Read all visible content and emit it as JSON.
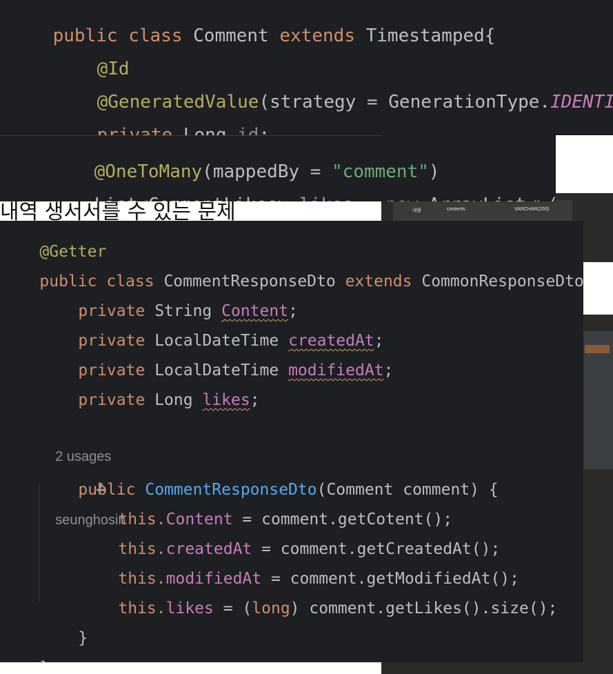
{
  "top_snippet": {
    "line1": {
      "kw1": "public",
      "kw2": "class",
      "name": "Comment",
      "kw3": "extends",
      "parent": "Timestamped{"
    },
    "line2": {
      "ann": "@Id"
    },
    "line3": {
      "ann": "@GeneratedValue",
      "open": "(strategy = GenerationType.",
      "value": "IDENTITY",
      "close": ")"
    },
    "line4": {
      "kw": "private",
      "type": "Long",
      "field": "id",
      "semi": ";"
    }
  },
  "mid_snippet": {
    "line1": {
      "ann": "@OneToMany",
      "open": "(mappedBy = ",
      "str": "\"comment\"",
      "close": ")"
    },
    "line2": {
      "type": "List<CommentLikes>",
      "field": "likes",
      "eq": " = ",
      "kw": "new",
      "rest": "ArrayList<>();"
    }
  },
  "background_text": "내역 생서서를 수 있는 문제",
  "table_fragment": {
    "row1": [
      "내용",
      "contents",
      "VARCHAR(200)"
    ]
  },
  "main_snippet": {
    "l1": {
      "ann": "@Getter"
    },
    "l2": {
      "kw1": "public",
      "kw2": "class",
      "name": "CommentResponseDto",
      "kw3": "extends",
      "parent": "CommonResponseDto{"
    },
    "l3": {
      "kw": "private",
      "type": "String",
      "field": "Content",
      "semi": ";"
    },
    "l4": {
      "kw": "private",
      "type": "LocalDateTime",
      "field": "createdAt",
      "semi": ";"
    },
    "l5": {
      "kw": "private",
      "type": "LocalDateTime",
      "field": "modifiedAt",
      "semi": ";"
    },
    "l6": {
      "kw": "private",
      "type": "Long",
      "field": "likes",
      "semi": ";"
    },
    "inlay": {
      "usages": "2 usages",
      "author_icon": "user-icon",
      "author": "seunghosin"
    },
    "l7": {
      "kw": "public",
      "ctor": "CommentResponseDto",
      "params": "(Comment comment) {"
    },
    "l8": {
      "this": "this.",
      "field": "Content",
      "rest": " = comment.getCotent();"
    },
    "l9": {
      "this": "this.",
      "field": "createdAt",
      "rest": " = comment.getCreatedAt();"
    },
    "l10": {
      "this": "this.",
      "field": "modifiedAt",
      "rest": " = comment.getModifiedAt();"
    },
    "l11": {
      "this": "this.",
      "field": "likes",
      "eq": " = (",
      "cast": "long",
      "rest": ") comment.getLikes().size();"
    },
    "l12": {
      "brace": "}"
    },
    "l13": {
      "brace": "}"
    }
  },
  "colors": {
    "editor_bg": "#1e1f22",
    "keyword": "#cf8e6d",
    "annotation": "#b3ae60",
    "field": "#c77dbb",
    "string": "#6aab73",
    "method": "#56a8f5",
    "text": "#bcbec4"
  }
}
